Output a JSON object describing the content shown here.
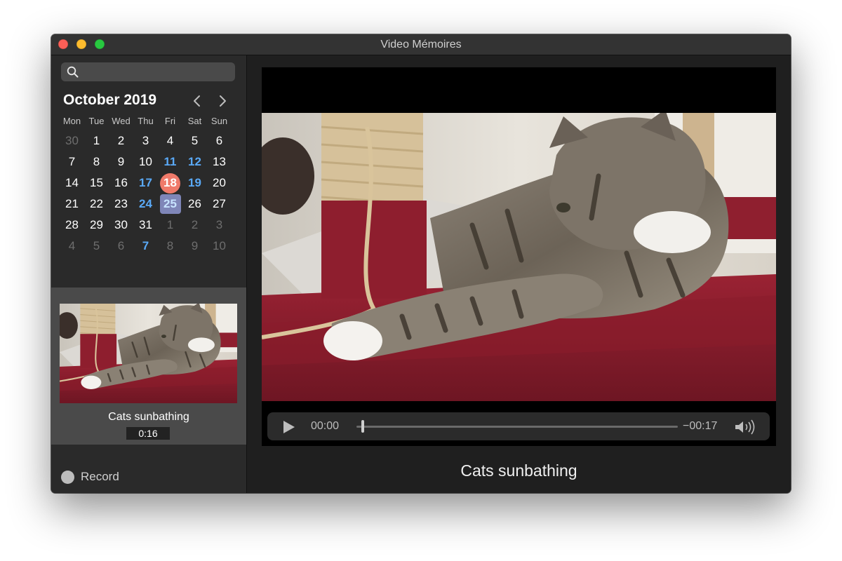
{
  "window": {
    "title": "Video Mémoires"
  },
  "sidebar": {
    "search": {
      "value": "",
      "placeholder": ""
    },
    "calendar": {
      "month_label": "October 2019",
      "weekdays": [
        "Mon",
        "Tue",
        "Wed",
        "Thu",
        "Fri",
        "Sat",
        "Sun"
      ],
      "weeks": [
        [
          {
            "d": "30",
            "muted": true
          },
          {
            "d": "1"
          },
          {
            "d": "2"
          },
          {
            "d": "3"
          },
          {
            "d": "4"
          },
          {
            "d": "5"
          },
          {
            "d": "6"
          }
        ],
        [
          {
            "d": "7"
          },
          {
            "d": "8"
          },
          {
            "d": "9"
          },
          {
            "d": "10"
          },
          {
            "d": "11",
            "hl": true
          },
          {
            "d": "12",
            "hl": true
          },
          {
            "d": "13"
          }
        ],
        [
          {
            "d": "14"
          },
          {
            "d": "15"
          },
          {
            "d": "16"
          },
          {
            "d": "17",
            "hl": true
          },
          {
            "d": "18",
            "today": true
          },
          {
            "d": "19",
            "hl": true
          },
          {
            "d": "20"
          }
        ],
        [
          {
            "d": "21"
          },
          {
            "d": "22"
          },
          {
            "d": "23"
          },
          {
            "d": "24",
            "hl": true
          },
          {
            "d": "25",
            "selected": true
          },
          {
            "d": "26"
          },
          {
            "d": "27"
          }
        ],
        [
          {
            "d": "28"
          },
          {
            "d": "29"
          },
          {
            "d": "30"
          },
          {
            "d": "31"
          },
          {
            "d": "1",
            "muted": true
          },
          {
            "d": "2",
            "muted": true
          },
          {
            "d": "3",
            "muted": true
          }
        ],
        [
          {
            "d": "4",
            "muted": true
          },
          {
            "d": "5",
            "muted": true
          },
          {
            "d": "6",
            "muted": true
          },
          {
            "d": "7",
            "hl": true
          },
          {
            "d": "8",
            "muted": true
          },
          {
            "d": "9",
            "muted": true
          },
          {
            "d": "10",
            "muted": true
          }
        ]
      ]
    },
    "video_item": {
      "title": "Cats sunbathing",
      "duration": "0:16"
    },
    "record_label": "Record"
  },
  "player": {
    "current_time": "00:00",
    "remaining_time": "−00:17",
    "progress": 0.02,
    "caption": "Cats sunbathing"
  },
  "colors": {
    "accent_today": "#f07a6a",
    "highlight_day": "#5aa9f6",
    "selected_day": "#7f86b8"
  }
}
